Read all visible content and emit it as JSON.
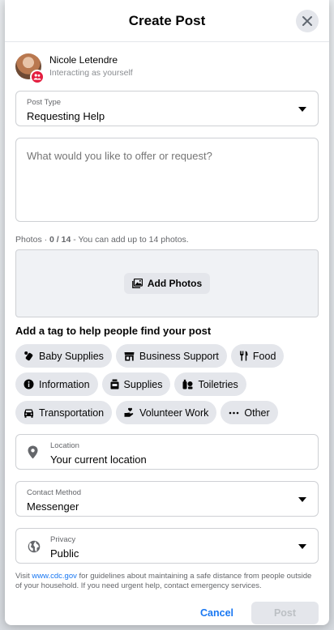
{
  "header": {
    "title": "Create Post"
  },
  "user": {
    "name": "Nicole Letendre",
    "subtitle": "Interacting as yourself"
  },
  "post_type": {
    "label": "Post Type",
    "value": "Requesting Help"
  },
  "description": {
    "placeholder": "What would you like to offer or request?"
  },
  "photos": {
    "label": "Photos",
    "count": "0 / 14",
    "hint": "You can add up to 14 photos.",
    "button": "Add Photos"
  },
  "tags": {
    "heading": "Add a tag to help people find your post",
    "items": [
      {
        "label": "Baby Supplies",
        "icon": "baby-bottle-icon"
      },
      {
        "label": "Business Support",
        "icon": "storefront-icon"
      },
      {
        "label": "Food",
        "icon": "utensils-icon"
      },
      {
        "label": "Information",
        "icon": "info-icon"
      },
      {
        "label": "Supplies",
        "icon": "jar-icon"
      },
      {
        "label": "Toiletries",
        "icon": "toiletries-icon"
      },
      {
        "label": "Transportation",
        "icon": "car-icon"
      },
      {
        "label": "Volunteer Work",
        "icon": "hand-heart-icon"
      },
      {
        "label": "Other",
        "icon": "more-dots-icon"
      }
    ]
  },
  "location": {
    "label": "Location",
    "value": "Your current location"
  },
  "contact": {
    "label": "Contact Method",
    "value": "Messenger"
  },
  "privacy": {
    "label": "Privacy",
    "value": "Public"
  },
  "footnote": {
    "prefix": "Visit ",
    "link": "www.cdc.gov",
    "suffix": " for guidelines about maintaining a safe distance from people outside of your household. If you need urgent help, contact emergency services."
  },
  "actions": {
    "cancel": "Cancel",
    "post": "Post"
  },
  "colors": {
    "accent": "#1877f2",
    "badge": "#e41e3f",
    "chip_bg": "#e4e6eb"
  }
}
